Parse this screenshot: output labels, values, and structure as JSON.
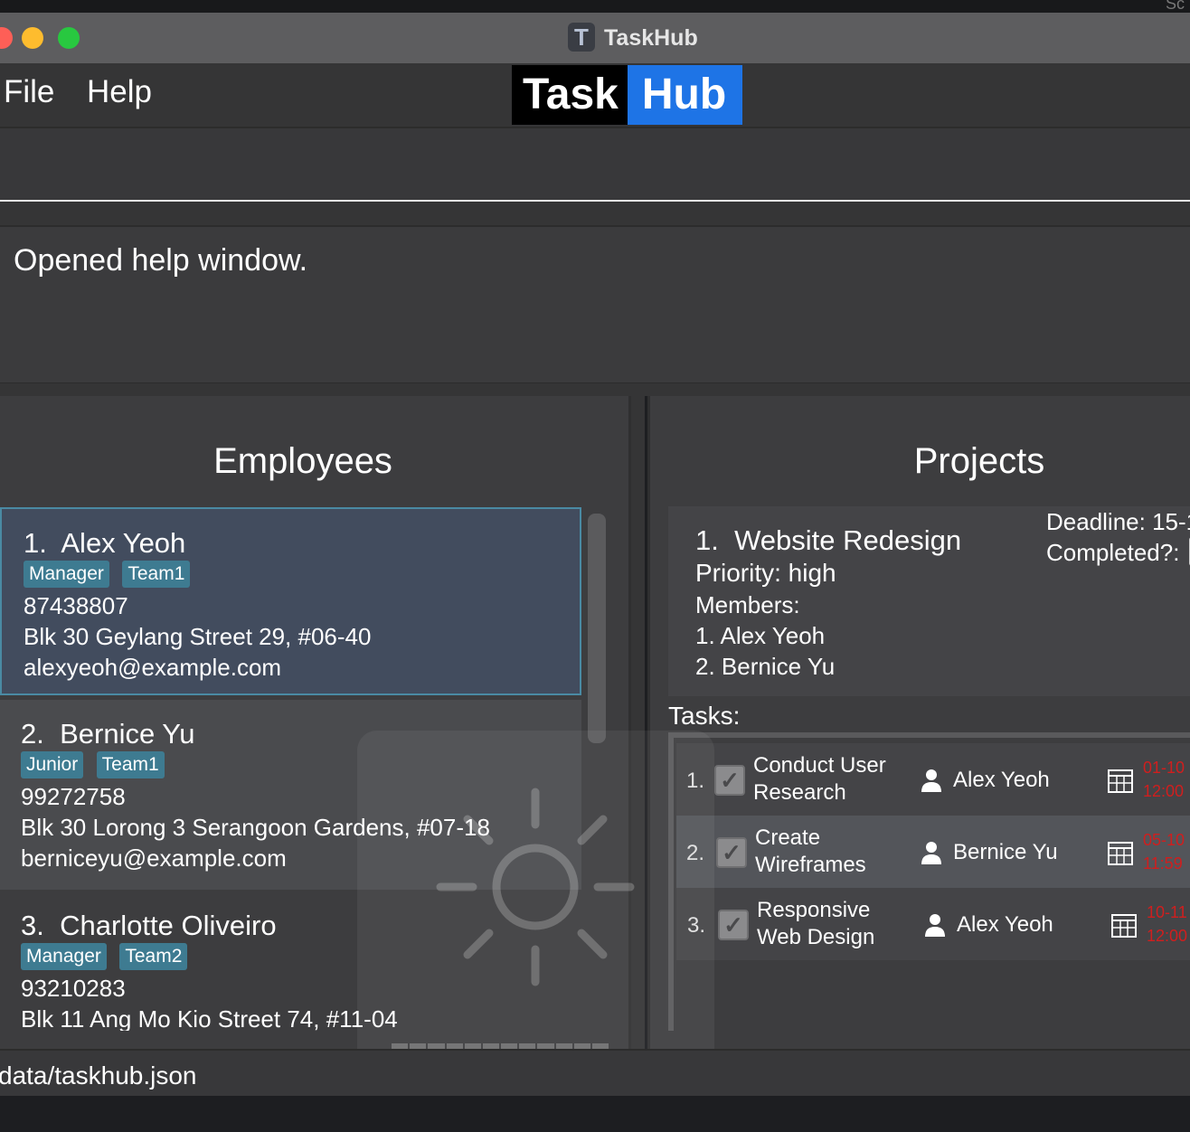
{
  "window": {
    "title": "TaskHub",
    "app_icon_letter": "T",
    "corner_text": "Sc"
  },
  "menu": {
    "file_label": "File",
    "help_label": "Help"
  },
  "logo": {
    "part1": "Task",
    "part2": "Hub"
  },
  "result": {
    "text": "Opened help window."
  },
  "employees": {
    "title": "Employees",
    "items": [
      {
        "index": "1.",
        "name": "Alex Yeoh",
        "tags": [
          "Manager",
          "Team1"
        ],
        "phone": "87438807",
        "address": "Blk 30 Geylang Street 29, #06-40",
        "email": "alexyeoh@example.com"
      },
      {
        "index": "2.",
        "name": "Bernice Yu",
        "tags": [
          "Junior",
          "Team1"
        ],
        "phone": "99272758",
        "address": "Blk 30 Lorong 3 Serangoon Gardens, #07-18",
        "email": "berniceyu@example.com"
      },
      {
        "index": "3.",
        "name": "Charlotte Oliveiro",
        "tags": [
          "Manager",
          "Team2"
        ],
        "phone": "93210283",
        "address": "Blk 11 Ang Mo Kio Street 74, #11-04",
        "email": ""
      }
    ]
  },
  "projects": {
    "title": "Projects",
    "items": [
      {
        "index": "1.",
        "name": "Website Redesign",
        "priority": "Priority: high",
        "deadline": "Deadline: 15-1",
        "completed_label": "Completed?:",
        "members_label": "Members:",
        "members": [
          "1. Alex Yeoh",
          "2. Bernice Yu"
        ],
        "tasks_label": "Tasks:",
        "tasks": [
          {
            "index": "1.",
            "title_line1": "Conduct User",
            "title_line2": "Research",
            "assignee": "Alex Yeoh",
            "date_line1": "01-10",
            "date_line2": "12:00"
          },
          {
            "index": "2.",
            "title_line1": "Create",
            "title_line2": "Wireframes",
            "assignee": "Bernice Yu",
            "date_line1": "05-10",
            "date_line2": "11:59"
          },
          {
            "index": "3.",
            "title_line1": "Responsive",
            "title_line2": "Web Design",
            "assignee": "Alex Yeoh",
            "date_line1": "10-11",
            "date_line2": "12:00"
          }
        ]
      }
    ]
  },
  "footer": {
    "path": "data/taskhub.json"
  },
  "colors": {
    "accent_blue": "#1e74e6",
    "tag_bg": "#3e7b91",
    "priority_red": "#e02020",
    "selected_card": "#424c5e"
  },
  "icons": [
    "close-light",
    "minimize-light",
    "zoom-light",
    "person-icon",
    "calendar-icon",
    "check-icon",
    "brightness-icon"
  ]
}
